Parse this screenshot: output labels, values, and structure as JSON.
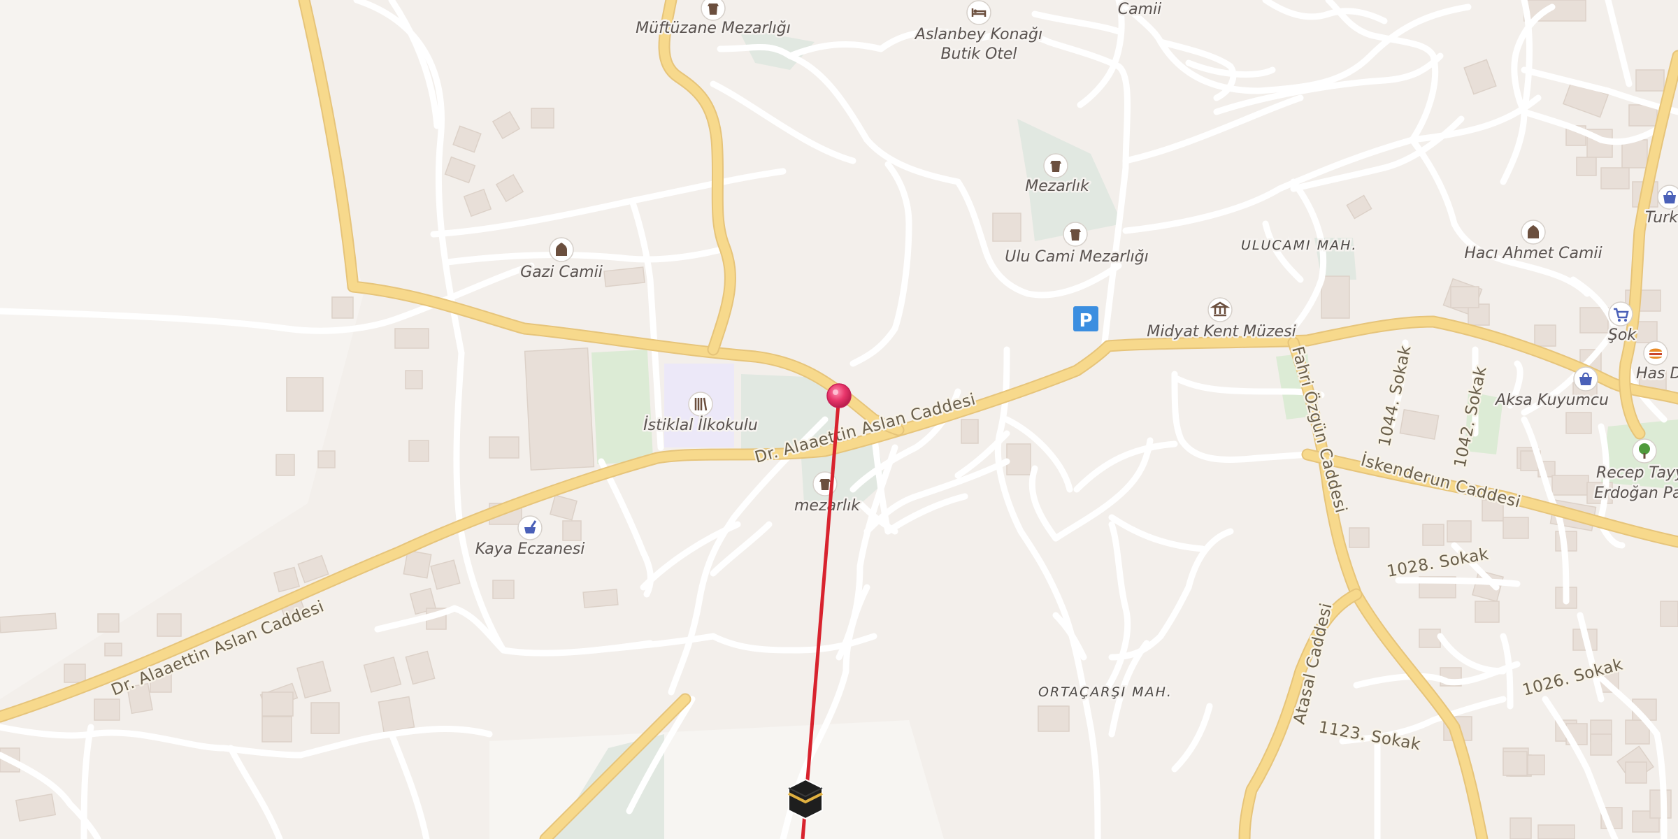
{
  "map": {
    "district_labels": [
      "ULUCAMI MAH.",
      "ORTAÇARŞI MAH."
    ],
    "street_labels": [
      "Dr. Alaaettin Aslan Caddesi",
      "Dr. Alaaettin Aslan Caddesi",
      "Fahri Özgün Caddesi",
      "İskenderun Caddesi",
      "1044. Sokak",
      "1042. Sokak",
      "1028. Sokak",
      "1026. Sokak",
      "1123. Sokak",
      "Atasal Caddesi"
    ],
    "pois": [
      {
        "label": "Müftüzane Mezarlığı",
        "icon": "cemetery-icon"
      },
      {
        "label": "Aslanbey Konağı",
        "label2": "Butik Otel",
        "icon": "hotel-icon"
      },
      {
        "label": "Camii",
        "icon": "mosque-icon"
      },
      {
        "label": "Mezarlık",
        "icon": "cemetery-icon"
      },
      {
        "label": "Ulu Cami Mezarlığı",
        "icon": "cemetery-icon"
      },
      {
        "label": "Gazi Camii",
        "icon": "mosque-icon"
      },
      {
        "label": "Hacı Ahmet Camii",
        "icon": "mosque-icon"
      },
      {
        "label": "Midyat Kent Müzesi",
        "icon": "museum-icon"
      },
      {
        "label": "İstiklal İlkokulu",
        "icon": "school-icon"
      },
      {
        "label": "mezarlık",
        "icon": "cemetery-icon"
      },
      {
        "label": "Kaya Eczanesi",
        "icon": "pharmacy-icon"
      },
      {
        "label": "Şok",
        "icon": "shopping-cart-icon"
      },
      {
        "label": "Has Don",
        "icon": "fast-food-icon"
      },
      {
        "label": "Aksa Kuyumcu",
        "icon": "shopping-bag-icon"
      },
      {
        "label": "Recep Tayy",
        "label2": "Erdoğan Pa",
        "icon": "park-tree-icon"
      },
      {
        "label": "Turk",
        "icon": "shopping-bag-icon"
      }
    ],
    "parking_symbol": "P",
    "colors": {
      "background": "#f3efeb",
      "major_road": "#f7d98c",
      "minor_road": "#ffffff",
      "building": "#e8dfd8",
      "park": "#dcebd5",
      "school_area": "#ece8f8",
      "qibla_line": "#d8232e",
      "pin": "#e8356a",
      "parking": "#3b8ee0"
    }
  }
}
